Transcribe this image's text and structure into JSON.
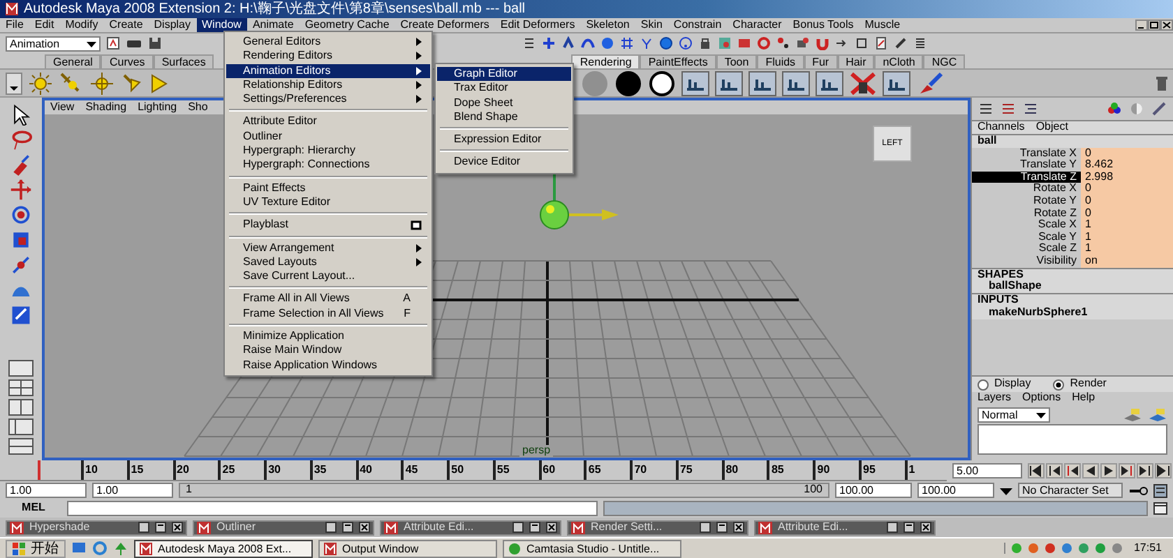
{
  "window": {
    "title": "Autodesk Maya 2008 Extension 2: H:\\鞠子\\光盘文件\\第8章\\senses\\ball.mb  ---  ball"
  },
  "menubar": [
    {
      "label": "File",
      "selected": false
    },
    {
      "label": "Edit",
      "selected": false
    },
    {
      "label": "Modify",
      "selected": false
    },
    {
      "label": "Create",
      "selected": false
    },
    {
      "label": "Display",
      "selected": false
    },
    {
      "label": "Window",
      "selected": true
    },
    {
      "label": "Animate",
      "selected": false
    },
    {
      "label": "Geometry Cache",
      "selected": false
    },
    {
      "label": "Create Deformers",
      "selected": false
    },
    {
      "label": "Edit Deformers",
      "selected": false
    },
    {
      "label": "Skeleton",
      "selected": false
    },
    {
      "label": "Skin",
      "selected": false
    },
    {
      "label": "Constrain",
      "selected": false
    },
    {
      "label": "Character",
      "selected": false
    },
    {
      "label": "Bonus Tools",
      "selected": false
    },
    {
      "label": "Muscle",
      "selected": false
    }
  ],
  "status_line": {
    "mode": "Animation"
  },
  "shelf_tabs": [
    {
      "label": "General",
      "selected": false
    },
    {
      "label": "Curves",
      "selected": false
    },
    {
      "label": "Surfaces",
      "selected": false
    },
    {
      "label": "Rendering",
      "selected": true
    },
    {
      "label": "PaintEffects",
      "selected": false
    },
    {
      "label": "Toon",
      "selected": false
    },
    {
      "label": "Fluids",
      "selected": false
    },
    {
      "label": "Fur",
      "selected": false
    },
    {
      "label": "Hair",
      "selected": false
    },
    {
      "label": "nCloth",
      "selected": false
    },
    {
      "label": "NGC",
      "selected": false
    }
  ],
  "panel_menu": [
    "View",
    "Shading",
    "Lighting",
    "Sho"
  ],
  "viewport": {
    "camera": "persp",
    "view_cube": "LEFT"
  },
  "window_menu": {
    "groups": [
      [
        {
          "label": "General Editors",
          "selected": false,
          "submenu": true
        },
        {
          "label": "Rendering Editors",
          "selected": false,
          "submenu": true
        },
        {
          "label": "Animation Editors",
          "selected": true,
          "submenu": true
        },
        {
          "label": "Relationship Editors",
          "selected": false,
          "submenu": true
        },
        {
          "label": "Settings/Preferences",
          "selected": false,
          "submenu": true
        }
      ],
      [
        {
          "label": "Attribute Editor",
          "selected": false
        },
        {
          "label": "Outliner",
          "selected": false
        },
        {
          "label": "Hypergraph: Hierarchy",
          "selected": false
        },
        {
          "label": "Hypergraph: Connections",
          "selected": false
        }
      ],
      [
        {
          "label": "Paint Effects",
          "selected": false
        },
        {
          "label": "UV Texture Editor",
          "selected": false
        }
      ],
      [
        {
          "label": "Playblast",
          "selected": false,
          "option_box": true
        }
      ],
      [
        {
          "label": "View Arrangement",
          "selected": false,
          "submenu": true
        },
        {
          "label": "Saved Layouts",
          "selected": false,
          "submenu": true
        },
        {
          "label": "Save Current Layout...",
          "selected": false
        }
      ],
      [
        {
          "label": "Frame All in All Views",
          "selected": false,
          "shortcut": "A"
        },
        {
          "label": "Frame Selection in All Views",
          "selected": false,
          "shortcut": "F"
        }
      ],
      [
        {
          "label": "Minimize Application",
          "selected": false
        },
        {
          "label": "Raise Main Window",
          "selected": false
        },
        {
          "label": "Raise Application Windows",
          "selected": false
        }
      ]
    ]
  },
  "submenu": {
    "groups": [
      [
        {
          "label": "Graph Editor",
          "selected": true
        },
        {
          "label": "Trax Editor",
          "selected": false
        },
        {
          "label": "Dope Sheet",
          "selected": false
        },
        {
          "label": "Blend Shape",
          "selected": false
        }
      ],
      [
        {
          "label": "Expression Editor",
          "selected": false
        }
      ],
      [
        {
          "label": "Device Editor",
          "selected": false
        }
      ]
    ]
  },
  "channel_box": {
    "tabs": [
      "Channels",
      "Object"
    ],
    "object": "ball",
    "channels": [
      {
        "name": "Translate X",
        "value": "0",
        "selected": false
      },
      {
        "name": "Translate Y",
        "value": "8.462",
        "selected": false
      },
      {
        "name": "Translate Z",
        "value": "2.998",
        "selected": true
      },
      {
        "name": "Rotate X",
        "value": "0",
        "selected": false
      },
      {
        "name": "Rotate Y",
        "value": "0",
        "selected": false
      },
      {
        "name": "Rotate Z",
        "value": "0",
        "selected": false
      },
      {
        "name": "Scale X",
        "value": "1",
        "selected": false
      },
      {
        "name": "Scale Y",
        "value": "1",
        "selected": false
      },
      {
        "name": "Scale Z",
        "value": "1",
        "selected": false
      },
      {
        "name": "Visibility",
        "value": "on",
        "selected": false
      }
    ],
    "shapes_header": "SHAPES",
    "shape": "ballShape",
    "inputs_header": "INPUTS",
    "input": "makeNurbSphere1"
  },
  "layer_editor": {
    "modes": [
      {
        "label": "Display",
        "selected": false
      },
      {
        "label": "Render",
        "selected": true
      }
    ],
    "menu": [
      "Layers",
      "Options",
      "Help"
    ],
    "blend_mode": "Normal"
  },
  "time_slider": {
    "ticks": [
      "10",
      "15",
      "20",
      "25",
      "30",
      "35",
      "40",
      "45",
      "50",
      "55",
      "60",
      "65",
      "70",
      "75",
      "80",
      "85",
      "90",
      "95",
      "1"
    ],
    "current_frame": "5.00",
    "level": 0.04
  },
  "range_slider": {
    "start": "1.00",
    "inner_start": "1.00",
    "range_start_label": "1",
    "range_end_label": "100",
    "level": 1,
    "inner_end": "100.00",
    "end": "100.00",
    "character_set": "No Character Set"
  },
  "command_line": {
    "label": "MEL"
  },
  "minimized_windows": [
    "Hypershade",
    "Outliner",
    "Attribute Edi...",
    "Render Setti...",
    "Attribute Edi..."
  ],
  "taskbar": {
    "start": "开始",
    "buttons": [
      {
        "label": "Autodesk Maya 2008 Ext...",
        "selected": true
      },
      {
        "label": "Output Window",
        "selected": false
      },
      {
        "label": "Camtasia Studio - Untitle...",
        "selected": false
      }
    ],
    "clock": "17:51"
  }
}
